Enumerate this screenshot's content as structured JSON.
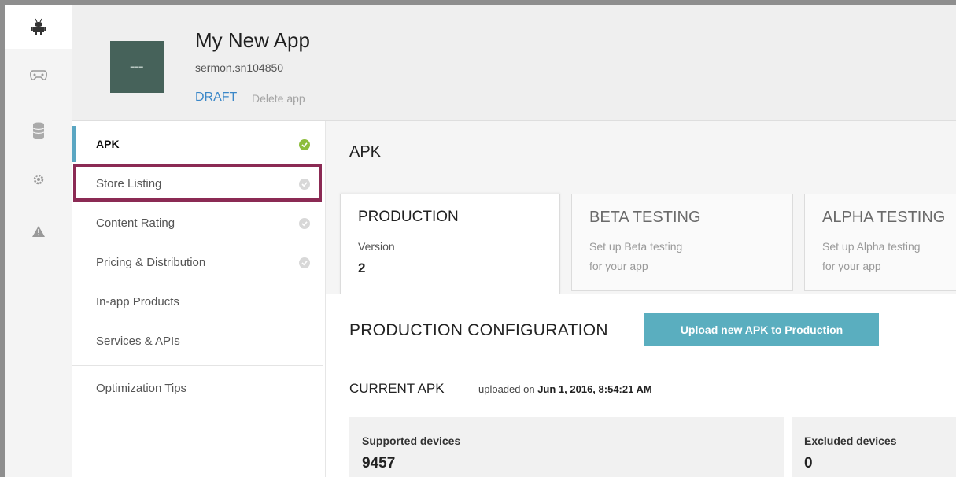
{
  "rail": {
    "icons": [
      "android-icon",
      "gamepad-icon",
      "database-icon",
      "gear-icon",
      "alert-icon"
    ]
  },
  "app": {
    "title": "My New App",
    "package": "sermon.sn104850",
    "status": "DRAFT",
    "delete_label": "Delete app"
  },
  "nav": {
    "items": [
      {
        "label": "APK",
        "status": "complete"
      },
      {
        "label": "Store Listing",
        "status": "incomplete"
      },
      {
        "label": "Content Rating",
        "status": "incomplete"
      },
      {
        "label": "Pricing & Distribution",
        "status": "incomplete"
      },
      {
        "label": "In-app Products"
      },
      {
        "label": "Services & APIs"
      },
      {
        "label": "Optimization Tips"
      }
    ]
  },
  "main": {
    "title": "APK",
    "tabs": [
      {
        "title": "PRODUCTION",
        "sub": "Version",
        "value": "2"
      },
      {
        "title": "BETA TESTING",
        "sub1": "Set up Beta testing",
        "sub2": "for your app"
      },
      {
        "title": "ALPHA TESTING",
        "sub1": "Set up Alpha testing",
        "sub2": "for your app"
      }
    ],
    "config_title": "PRODUCTION CONFIGURATION",
    "upload_button": "Upload new APK to Production",
    "current_title": "CURRENT APK",
    "uploaded_prefix": "uploaded on",
    "uploaded_date": "Jun 1, 2016, 8:54:21 AM",
    "stats": [
      {
        "label": "Supported devices",
        "value": "9457"
      },
      {
        "label": "Excluded devices",
        "value": "0"
      }
    ]
  },
  "colors": {
    "accent": "#5aaebf",
    "draft": "#3a87c8",
    "highlight": "#8b2a54",
    "check_ok": "#8dbd3b"
  }
}
